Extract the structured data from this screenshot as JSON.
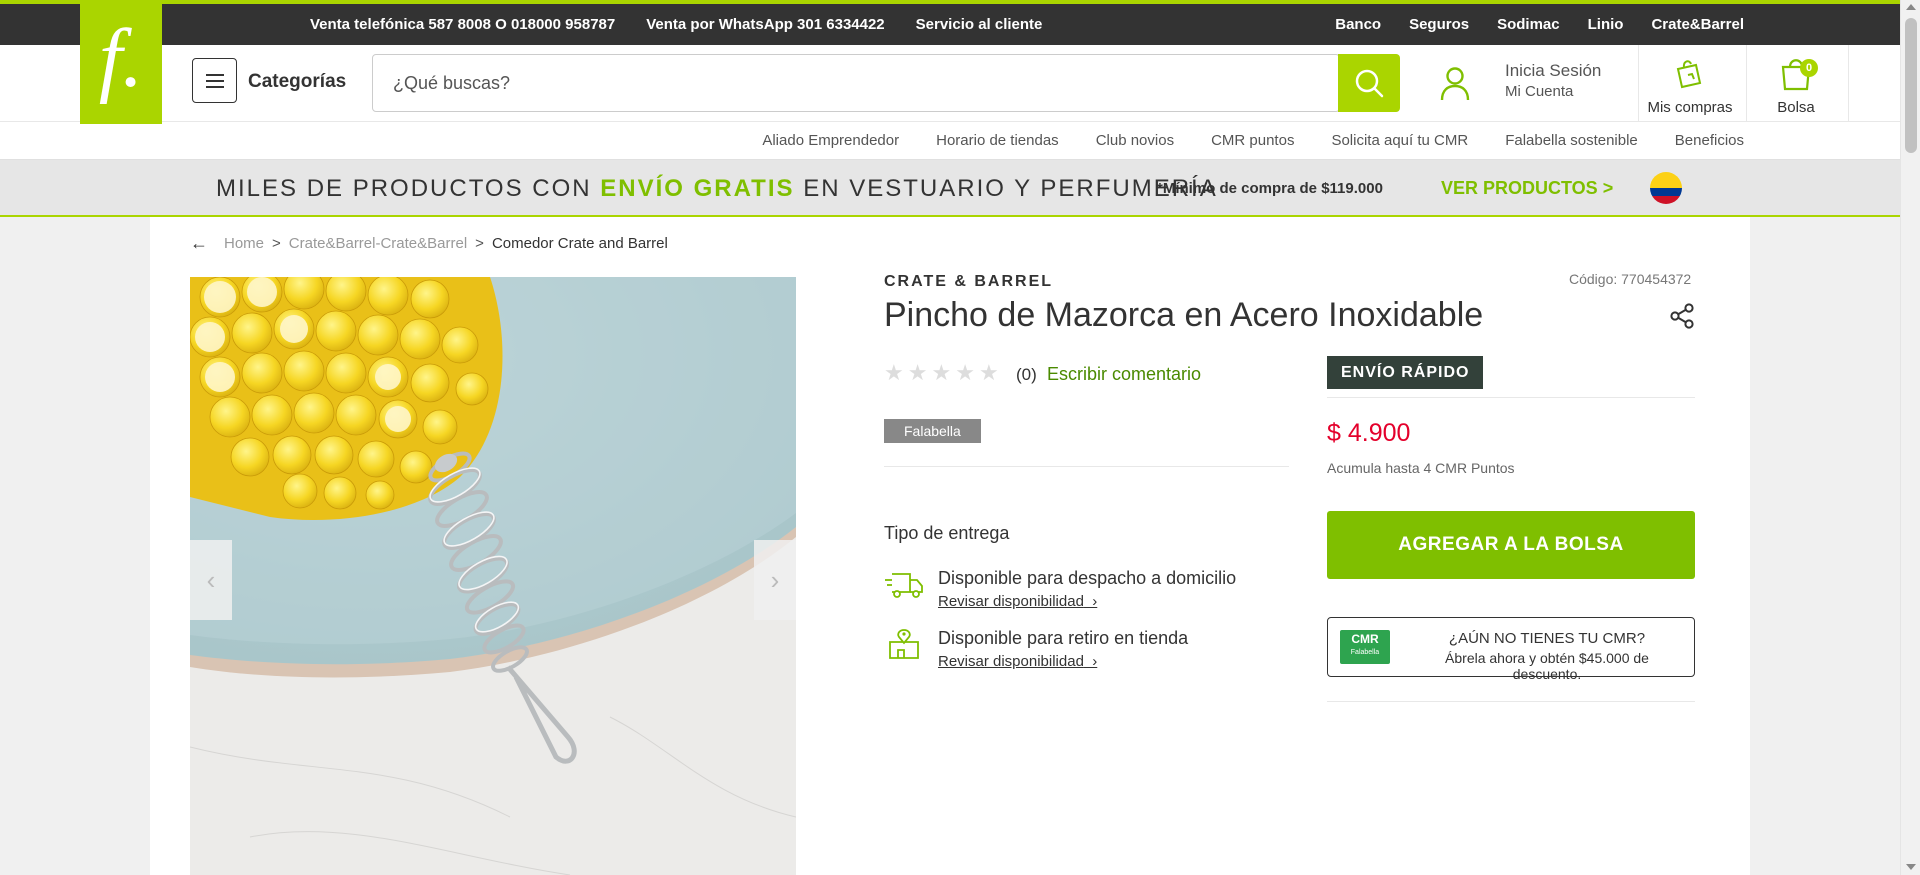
{
  "topbar": {
    "phone_sales": "Venta telefónica 587 8008 O 018000 958787",
    "whatsapp_sales": "Venta por WhatsApp 301 6334422",
    "customer_service": "Servicio al cliente",
    "right_links": [
      "Banco",
      "Seguros",
      "Sodimac",
      "Linio",
      "Crate&Barrel"
    ]
  },
  "logo": {
    "glyph": "f."
  },
  "header": {
    "categories_label": "Categorías",
    "search_placeholder": "¿Qué buscas?",
    "login_line1": "Inicia Sesión",
    "login_line2": "Mi Cuenta",
    "purchases_label": "Mis compras",
    "bag_label": "Bolsa",
    "bag_count": "0"
  },
  "subnav": {
    "items": [
      "Aliado Emprendedor",
      "Horario de tiendas",
      "Club novios",
      "CMR puntos",
      "Solicita aquí tu CMR",
      "Falabella sostenible",
      "Beneficios"
    ]
  },
  "banner": {
    "text_before": "MILES DE PRODUCTOS CON",
    "highlight": "ENVÍO GRATIS",
    "text_after": "EN VESTUARIO Y PERFUMERÍA",
    "minimum": "*Mínimo de compra de $119.000",
    "cta": "VER PRODUCTOS >"
  },
  "breadcrumb": {
    "items": [
      "Home",
      "Crate&Barrel-Crate&Barrel"
    ],
    "current": "Comedor Crate and Barrel",
    "separator": ">"
  },
  "product": {
    "brand": "CRATE & BARREL",
    "sku": "Código: 770454372",
    "title": "Pincho de Mazorca en Acero Inoxidable",
    "rating": 0,
    "review_count": "(0)",
    "write_review": "Escribir comentario",
    "badge": "ENVÍO RÁPIDO",
    "seller": "Falabella",
    "price": "$ 4.900",
    "points": "Acumula hasta 4 CMR Puntos"
  },
  "delivery": {
    "title": "Tipo de entrega",
    "home": {
      "label": "Disponible para despacho a domicilio",
      "link": "Revisar disponibilidad"
    },
    "store": {
      "label": "Disponible para retiro en tienda",
      "link": "Revisar disponibilidad"
    }
  },
  "cart": {
    "add_label": "AGREGAR A LA BOLSA"
  },
  "cmr_promo": {
    "logo_top": "CMR",
    "logo_bottom": "Falabella",
    "question": "¿AÚN NO TIENES TU CMR?",
    "description": "Ábrela ahora y obtén $45.000 de descuento."
  },
  "gallery": {
    "prev": "‹",
    "next": "›"
  },
  "colors": {
    "brand_green": "#aad500",
    "button_green": "#7fbf00",
    "price_red": "#e4002b",
    "topbar": "#333333",
    "badge_dark": "#33413a"
  },
  "icons": [
    "menu-icon",
    "search-icon",
    "user-icon",
    "shopping-bags-icon",
    "bag-icon",
    "share-icon",
    "back-arrow-icon",
    "truck-icon",
    "store-pin-icon",
    "star-icon",
    "colombia-flag-icon"
  ]
}
